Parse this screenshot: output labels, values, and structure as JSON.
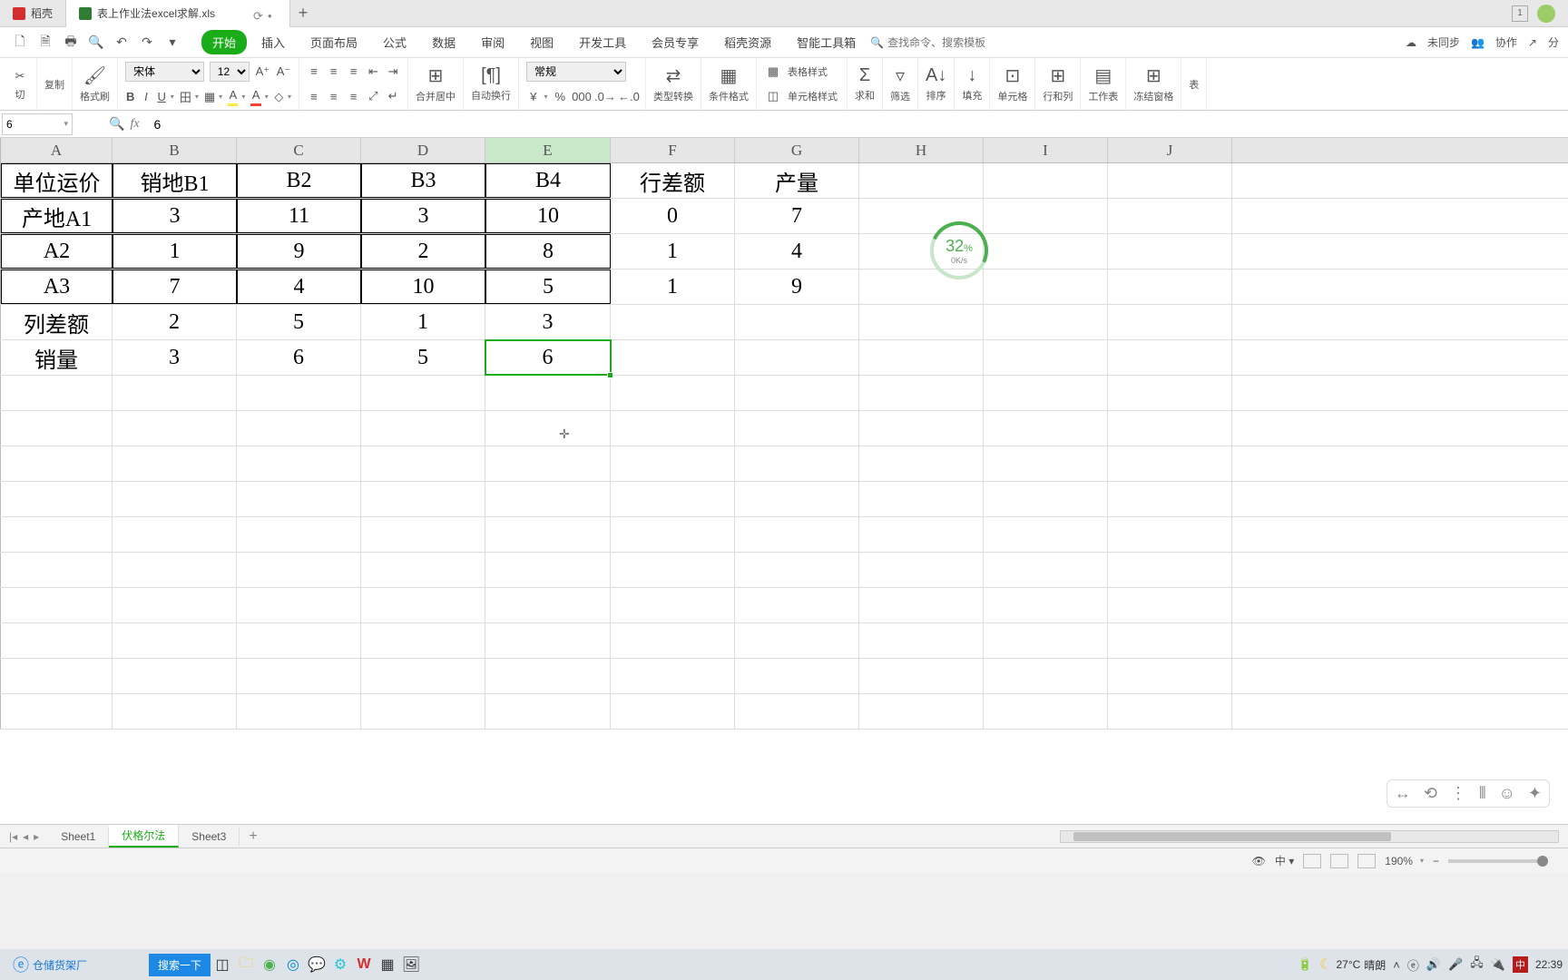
{
  "app": {
    "name": "稻壳",
    "doc_tab": "表上作业法excel求解.xls"
  },
  "menu": {
    "items": [
      "开始",
      "插入",
      "页面布局",
      "公式",
      "数据",
      "审阅",
      "视图",
      "开发工具",
      "会员专享",
      "稻壳资源",
      "智能工具箱"
    ],
    "active": 0,
    "search_placeholder": "查找命令、搜索模板",
    "right": {
      "sync": "未同步",
      "collab": "协作",
      "share": "分"
    }
  },
  "quick": {
    "copy": "复制",
    "fmt": "格式刷"
  },
  "ribbon": {
    "font_name": "宋体",
    "font_size": "12",
    "merge": "合并居中",
    "wrap": "自动换行",
    "numfmt": "常规",
    "typeconv": "类型转换",
    "condfmt": "条件格式",
    "tblstyle": "表格样式",
    "cellstyle": "单元格样式",
    "sum": "求和",
    "filter": "筛选",
    "sort": "排序",
    "fill": "填充",
    "cellsize": "单元格",
    "rowcol": "行和列",
    "sheet": "工作表",
    "freeze": "冻结窗格",
    "table_end": "表"
  },
  "namebox": "6",
  "formula": "6",
  "columns": [
    "A",
    "B",
    "C",
    "D",
    "E",
    "F",
    "G",
    "H",
    "I",
    "J"
  ],
  "selected_col": "E",
  "rows": [
    [
      "单位运价",
      "销地B1",
      "B2",
      "B3",
      "B4",
      "行差额",
      "产量",
      "",
      "",
      ""
    ],
    [
      "产地A1",
      "3",
      "11",
      "3",
      "10",
      "0",
      "7",
      "",
      "",
      ""
    ],
    [
      "A2",
      "1",
      "9",
      "2",
      "8",
      "1",
      "4",
      "",
      "",
      ""
    ],
    [
      "A3",
      "7",
      "4",
      "10",
      "5",
      "1",
      "9",
      "",
      "",
      ""
    ],
    [
      "列差额",
      "2",
      "5",
      "1",
      "3",
      "",
      "",
      "",
      "",
      ""
    ],
    [
      "销量",
      "3",
      "6",
      "5",
      "6",
      "",
      "",
      "",
      "",
      ""
    ]
  ],
  "chart_data": {
    "type": "table",
    "title": "单位运价",
    "col_headers": [
      "销地B1",
      "B2",
      "B3",
      "B4",
      "行差额",
      "产量"
    ],
    "row_headers": [
      "产地A1",
      "A2",
      "A3",
      "列差额",
      "销量"
    ],
    "grid": [
      [
        3,
        11,
        3,
        10,
        0,
        7
      ],
      [
        1,
        9,
        2,
        8,
        1,
        4
      ],
      [
        7,
        4,
        10,
        5,
        1,
        9
      ],
      [
        2,
        5,
        1,
        3,
        null,
        null
      ],
      [
        3,
        6,
        5,
        6,
        null,
        null
      ]
    ]
  },
  "bordered": {
    "rows": [
      0,
      1,
      2,
      3
    ],
    "cols": [
      0,
      1,
      2,
      3,
      4
    ]
  },
  "selected_cell": {
    "r": 5,
    "c": 4
  },
  "speed": {
    "pct": "32",
    "unit": "%",
    "rate": "0K/s"
  },
  "sheets": {
    "tabs": [
      "Sheet1",
      "伏格尔法",
      "Sheet3"
    ],
    "active": 1
  },
  "status": {
    "zoom": "190%"
  },
  "taskbar": {
    "left_app": "仓储货架厂",
    "search": "搜索一下",
    "weather_temp": "27°C",
    "weather_desc": "晴朗",
    "ime": "中",
    "time": "22:39"
  }
}
